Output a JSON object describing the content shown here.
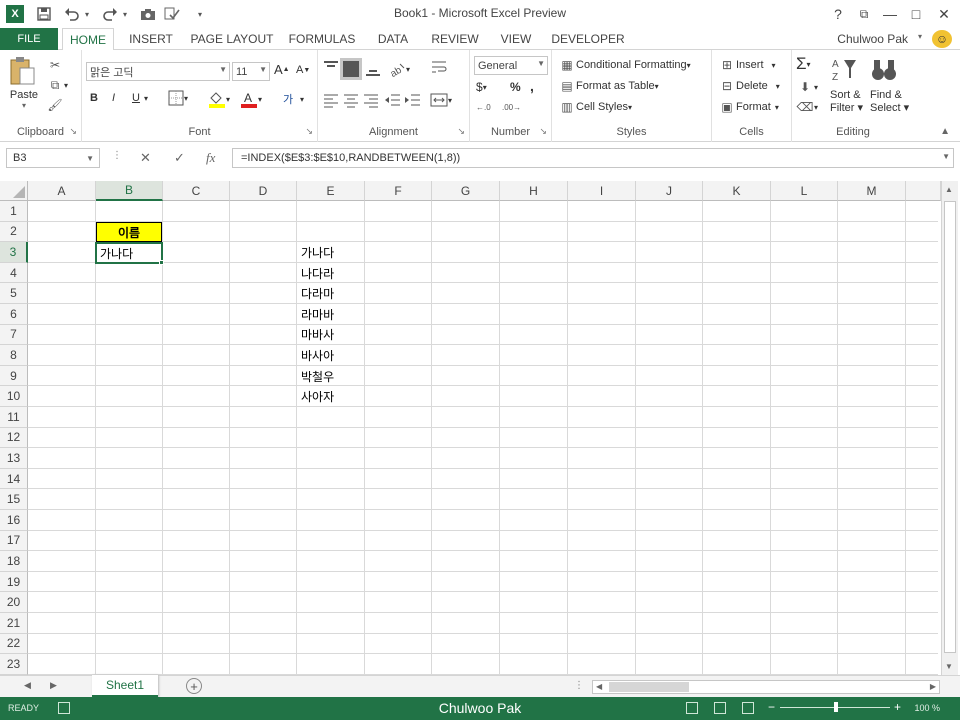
{
  "window": {
    "title": "Book1 - Microsoft Excel Preview",
    "help": "?",
    "ribbon_display": "⧉",
    "minimize": "—",
    "maximize": "□",
    "close": "✕"
  },
  "quick_access": [
    {
      "name": "save-icon",
      "glyph": "💾"
    },
    {
      "name": "undo-icon",
      "glyph": "↶"
    },
    {
      "name": "redo-icon",
      "glyph": "↷"
    },
    {
      "name": "camera-icon",
      "glyph": "📷"
    },
    {
      "name": "spellcheck-icon",
      "glyph": "✓"
    },
    {
      "name": "customize-qat-icon",
      "glyph": "▾"
    }
  ],
  "logo_text": "X",
  "ribbon_tabs": {
    "file": "FILE",
    "tabs": [
      "HOME",
      "INSERT",
      "PAGE LAYOUT",
      "FORMULAS",
      "DATA",
      "REVIEW",
      "VIEW",
      "DEVELOPER"
    ],
    "active": "HOME"
  },
  "user": {
    "name": "Chulwoo Pak",
    "avatar_glyph": "☺"
  },
  "ribbon": {
    "clipboard": {
      "label": "Clipboard",
      "paste": "Paste"
    },
    "font": {
      "label": "Font",
      "font_name": "맑은 고딕",
      "font_size": "11",
      "bold": "B",
      "italic": "I",
      "underline": "U",
      "grow": "A",
      "shrink": "A"
    },
    "alignment": {
      "label": "Alignment"
    },
    "number": {
      "label": "Number",
      "format": "General",
      "currency": "$",
      "percent": "%",
      "comma": ","
    },
    "styles": {
      "label": "Styles",
      "conditional": "Conditional Formatting",
      "format_table": "Format as Table",
      "cell_styles": "Cell Styles"
    },
    "cells": {
      "label": "Cells",
      "insert": "Insert",
      "delete": "Delete",
      "format": "Format"
    },
    "editing": {
      "label": "Editing",
      "sum": "Σ",
      "sort_filter_1": "Sort &",
      "sort_filter_2": "Filter",
      "find_select_1": "Find &",
      "find_select_2": "Select"
    }
  },
  "formula_bar": {
    "name_box": "B3",
    "cancel": "✕",
    "enter": "✓",
    "fx": "fx",
    "formula": "=INDEX($E$3:$E$10,RANDBETWEEN(1,8))"
  },
  "columns": [
    "A",
    "B",
    "C",
    "D",
    "E",
    "F",
    "G",
    "H",
    "I",
    "J",
    "K",
    "L",
    "M"
  ],
  "rows": [
    "1",
    "2",
    "3",
    "4",
    "5",
    "6",
    "7",
    "8",
    "9",
    "10",
    "11",
    "12",
    "13",
    "14",
    "15",
    "16",
    "17",
    "18",
    "19",
    "20",
    "21",
    "22",
    "23"
  ],
  "selected": {
    "col": "B",
    "row": "3"
  },
  "cells": {
    "B2": "이름",
    "B3": "가나다",
    "E_values": [
      "가나다",
      "나다라",
      "다라마",
      "라마바",
      "마바사",
      "바사아",
      "박철우",
      "사아자"
    ]
  },
  "sheet_tabs": {
    "active": "Sheet1",
    "add": "+"
  },
  "status": {
    "ready": "READY",
    "caption": "Chulwoo Pak",
    "zoom": "100 %"
  },
  "colors": {
    "accent": "#217346",
    "header_fill": "#ffff00"
  }
}
